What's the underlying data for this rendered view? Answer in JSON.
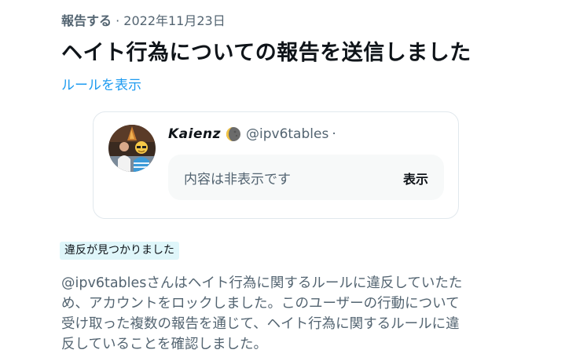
{
  "header": {
    "label": "報告する",
    "separator": " · ",
    "date": "2022年11月23日"
  },
  "title": "ヘイト行為についての報告を送信しました",
  "rules_link": "ルールを表示",
  "card": {
    "author_name": "Kaienz",
    "moon_icon": "moon-emoji-icon",
    "handle": "@ipv6tables",
    "dot": "·",
    "hidden_text": "内容は非表示です",
    "show_button": "表示"
  },
  "badge": "違反が見つかりました",
  "body_lines": [
    "@ipv6tablesさんはヘイト行為に関するルールに違反していたた",
    "め、アカウントをロックしました。このユーザーの行動について",
    "受け取った複数の報告を通じて、ヘイト行為に関するルールに違",
    "反していることを確認しました。"
  ],
  "colors": {
    "primary_text": "#0f1419",
    "secondary_text": "#536471",
    "link": "#1d9bf0",
    "badge_bg": "#dff6fa",
    "hidden_box_bg": "#f7f9f9"
  }
}
